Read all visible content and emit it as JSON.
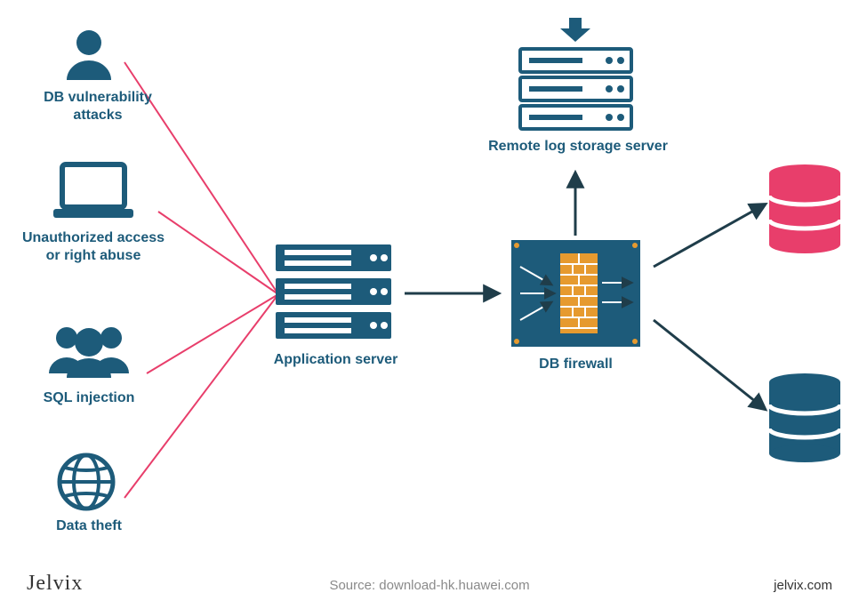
{
  "threats": [
    {
      "label": "DB vulnerability\nattacks",
      "icon": "person"
    },
    {
      "label": "Unauthorized access\nor right abuse",
      "icon": "laptop"
    },
    {
      "label": "SQL injection",
      "icon": "group"
    },
    {
      "label": "Data theft",
      "icon": "globe"
    }
  ],
  "nodes": {
    "app_server": "Application server",
    "db_firewall": "DB firewall",
    "remote_log": "Remote log storage server"
  },
  "footer": {
    "brand": "Jelvix",
    "source": "Source: download-hk.huawei.com",
    "site": "jelvix.com"
  },
  "colors": {
    "blue": "#1d5b7a",
    "red": "#e83e6b",
    "orange": "#e69a2f",
    "dark": "#1f3d4a",
    "gray": "#8a8a8a"
  }
}
